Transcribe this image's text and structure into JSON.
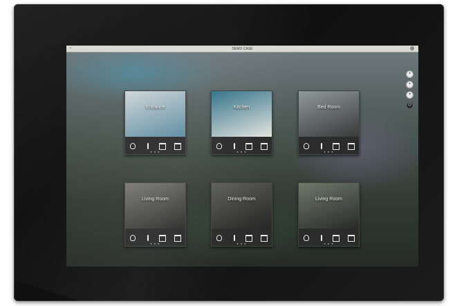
{
  "screen": {
    "title": "DEMO CASE",
    "back_label": "‹"
  },
  "side_buttons": [
    {
      "icon": "circle-icon",
      "label": "•"
    },
    {
      "icon": "circle-icon",
      "label": "•"
    },
    {
      "icon": "circle-icon",
      "label": "•"
    },
    {
      "icon": "power-icon",
      "label": "⏻"
    }
  ],
  "rooms": [
    {
      "name": "Entrance",
      "photo_colors": [
        "#cfd6d8",
        "#5a8aa0"
      ]
    },
    {
      "name": "Kitchen",
      "photo_colors": [
        "#2e6f86",
        "#e5e5e0"
      ]
    },
    {
      "name": "Bed Room",
      "photo_colors": [
        "#8f9a9a",
        "#3a3a3a"
      ]
    },
    {
      "name": "Living Room",
      "photo_colors": [
        "#7a7a78",
        "#2c2c2c"
      ]
    },
    {
      "name": "Dining Room",
      "photo_colors": [
        "#5e5e5c",
        "#262626"
      ]
    },
    {
      "name": "Living Room",
      "photo_colors": [
        "#6e7a6a",
        "#2a2a2a"
      ]
    }
  ],
  "tile_controls": [
    "light",
    "temperature",
    "blind",
    "blind"
  ],
  "page_indicator": "● ● ●"
}
